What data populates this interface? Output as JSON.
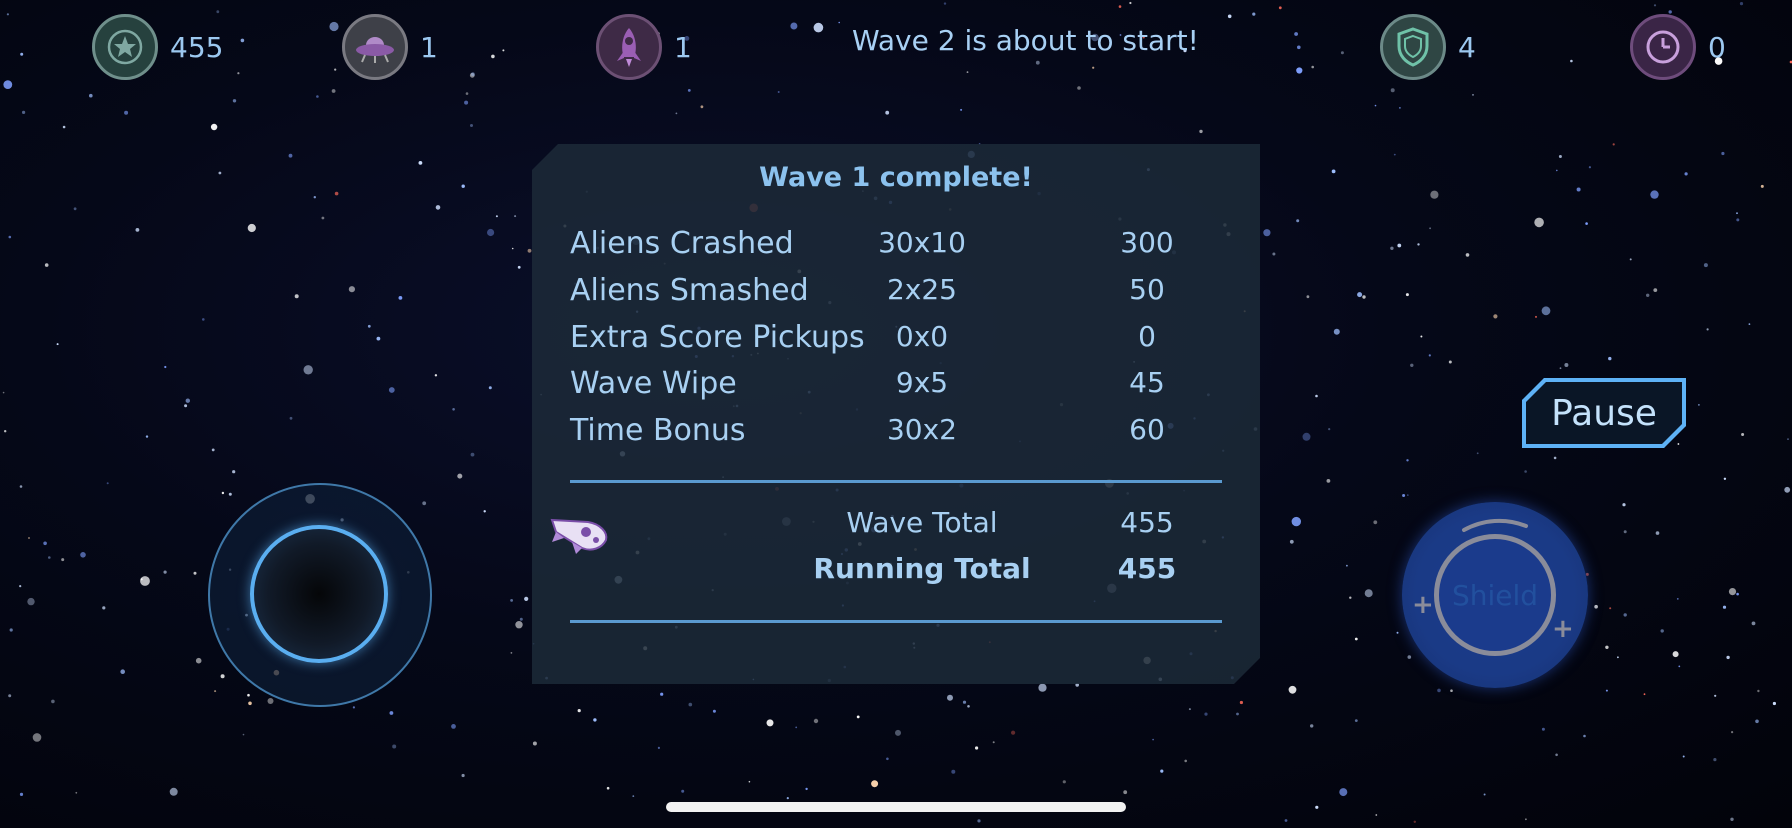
{
  "hud": {
    "score": {
      "icon": "star-icon",
      "value": "455"
    },
    "ufo": {
      "icon": "ufo-icon",
      "value": "1"
    },
    "rocket": {
      "icon": "rocket-icon",
      "value": "1"
    },
    "wave_message": "Wave 2 is about to start!",
    "shield": {
      "icon": "shield-icon",
      "value": "4"
    },
    "clock": {
      "icon": "clock-icon",
      "value": "0"
    }
  },
  "results": {
    "title": "Wave 1 complete!",
    "rows": [
      {
        "label": "Aliens Crashed",
        "multiplier": "30x10",
        "points": "300"
      },
      {
        "label": "Aliens Smashed",
        "multiplier": "2x25",
        "points": "50"
      },
      {
        "label": "Extra Score Pickups",
        "multiplier": "0x0",
        "points": "0"
      },
      {
        "label": "Wave Wipe",
        "multiplier": "9x5",
        "points": "45"
      },
      {
        "label": "Time Bonus",
        "multiplier": "30x2",
        "points": "60"
      }
    ],
    "wave_total_label": "Wave Total",
    "wave_total_value": "455",
    "running_total_label": "Running Total",
    "running_total_value": "455"
  },
  "controls": {
    "pause_label": "Pause",
    "shield_label": "Shield"
  },
  "colors": {
    "accent": "#5eb2f6",
    "text": "#a8d0f2",
    "panel": "#1c2a38",
    "shield_button": "#1a3a86"
  }
}
